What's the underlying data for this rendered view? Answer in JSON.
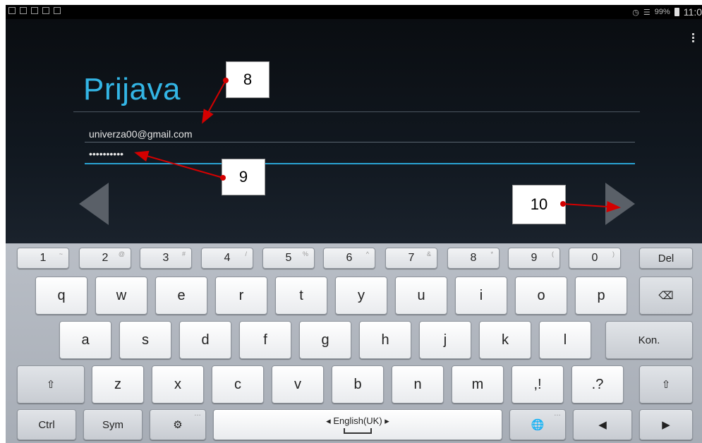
{
  "status_bar": {
    "battery": "99%",
    "time": "11:0"
  },
  "screen": {
    "title": "Prijava",
    "email_value": "univerza00@gmail.com",
    "password_value": "••••••••••",
    "menu_icon": "overflow-menu-icon",
    "prev_icon": "arrow-left-icon",
    "next_icon": "arrow-right-icon"
  },
  "annotations": {
    "callout_8": "8",
    "callout_9": "9",
    "callout_10": "10"
  },
  "keyboard": {
    "numbers": [
      {
        "label": "1",
        "alt": "~"
      },
      {
        "label": "2",
        "alt": "@"
      },
      {
        "label": "3",
        "alt": "#"
      },
      {
        "label": "4",
        "alt": "/"
      },
      {
        "label": "5",
        "alt": "%"
      },
      {
        "label": "6",
        "alt": "^"
      },
      {
        "label": "7",
        "alt": "&"
      },
      {
        "label": "8",
        "alt": "*"
      },
      {
        "label": "9",
        "alt": "("
      },
      {
        "label": "0",
        "alt": ")"
      }
    ],
    "del": "Del",
    "row1": [
      "q",
      "w",
      "e",
      "r",
      "t",
      "y",
      "u",
      "i",
      "o",
      "p"
    ],
    "row2": [
      "a",
      "s",
      "d",
      "f",
      "g",
      "h",
      "j",
      "k",
      "l"
    ],
    "row3": [
      "z",
      "x",
      "c",
      "v",
      "b",
      "n",
      "m"
    ],
    "comma": ",!",
    "period": ".?",
    "enter": "Kon.",
    "ctrl": "Ctrl",
    "sym": "Sym",
    "space_language": "English(UK)",
    "icons": {
      "backspace": "backspace-icon",
      "shift": "shift-icon",
      "settings": "gear-icon",
      "language": "globe-icon",
      "left": "cursor-left-icon",
      "right": "cursor-right-icon"
    },
    "colors": {
      "accent": "#33b5e5",
      "background": "#0b0f14"
    }
  }
}
